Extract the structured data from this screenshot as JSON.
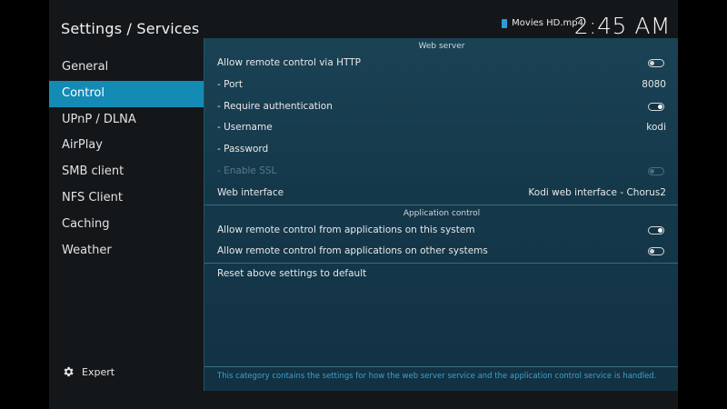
{
  "header": {
    "title": "Settings / Services",
    "now_playing": "Movies HD.mp4",
    "clock": "2:45 AM"
  },
  "sidebar": {
    "items": [
      {
        "label": "General"
      },
      {
        "label": "Control",
        "active": true
      },
      {
        "label": "UPnP / DLNA"
      },
      {
        "label": "AirPlay"
      },
      {
        "label": "SMB client"
      },
      {
        "label": "NFS Client"
      },
      {
        "label": "Caching"
      },
      {
        "label": "Weather"
      }
    ],
    "expert_label": "Expert"
  },
  "main": {
    "web_server": {
      "header": "Web server",
      "allow_http": {
        "label": "Allow remote control via HTTP",
        "enabled": false
      },
      "port": {
        "label": "- Port",
        "value": "8080"
      },
      "require_auth": {
        "label": "- Require authentication",
        "enabled": true
      },
      "username": {
        "label": "- Username",
        "value": "kodi"
      },
      "password": {
        "label": "- Password"
      },
      "enable_ssl": {
        "label": "- Enable SSL",
        "enabled": false,
        "disabled": true
      },
      "web_interface": {
        "label": "Web interface",
        "value": "Kodi web interface - Chorus2"
      }
    },
    "application_control": {
      "header": "Application control",
      "this_system": {
        "label": "Allow remote control from applications on this system",
        "enabled": true
      },
      "other_systems": {
        "label": "Allow remote control from applications on other systems",
        "enabled": false
      }
    },
    "reset_label": "Reset above settings to default",
    "info_text": "This category contains the settings for how the web server service and the application control service is handled."
  },
  "colors": {
    "accent": "#138bb5",
    "panel": "#173c4f",
    "info_text": "#3fa0c9"
  }
}
